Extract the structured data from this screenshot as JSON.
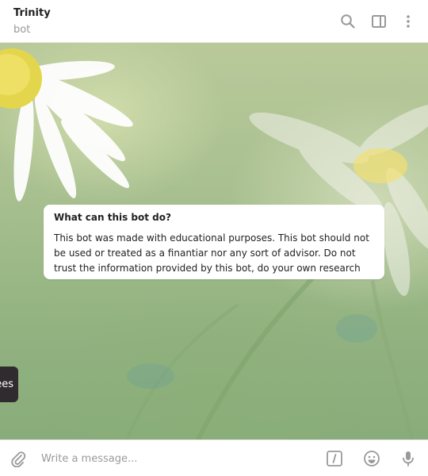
{
  "header": {
    "title": "Trinity",
    "status": "bot",
    "icons": [
      "search-icon",
      "sidebar-panel-icon",
      "more-vertical-icon"
    ]
  },
  "info_card": {
    "title": "What can this bot do?",
    "body": "This bot was made with educational purposes. This bot should not be used or treated as a finantiar nor any sort of advisor. Do not trust the information provided by this bot, do your own research"
  },
  "side_chip": {
    "text": "ees"
  },
  "composer": {
    "placeholder": "Write a message...",
    "icons": [
      "paperclip-icon",
      "bot-commands-icon",
      "emoji-icon",
      "microphone-icon"
    ]
  },
  "colors": {
    "icon_gray": "#999999",
    "title_text": "#222222",
    "status_text": "#999999"
  }
}
